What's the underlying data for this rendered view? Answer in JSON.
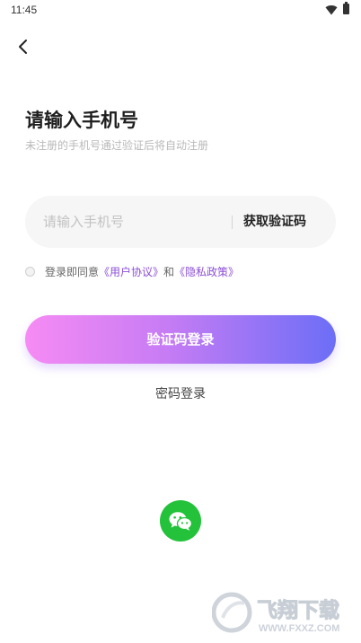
{
  "status_bar": {
    "time": "11:45"
  },
  "header": {
    "back_icon": "chevron-left-icon"
  },
  "page": {
    "title": "请输入手机号",
    "subtitle": "未注册的手机号通过验证后将自动注册"
  },
  "phone_field": {
    "placeholder": "请输入手机号",
    "value": "",
    "get_code_label": "获取验证码"
  },
  "agreement": {
    "prefix": "登录即同意",
    "user_agreement": "《用户协议》",
    "conjunction": "和",
    "privacy_policy": "《隐私政策》",
    "checked": false
  },
  "buttons": {
    "code_login_label": "验证码登录",
    "password_login_label": "密码登录"
  },
  "third_party": {
    "wechat_icon": "wechat-icon"
  },
  "watermark": {
    "text": "飞翔下载",
    "url_text": "WWW.FXXZ.COM"
  },
  "colors": {
    "gradient_start": "#f68bf4",
    "gradient_end": "#6c6ef7",
    "link": "#8c4fd6",
    "wechat_green": "#23c23a"
  }
}
